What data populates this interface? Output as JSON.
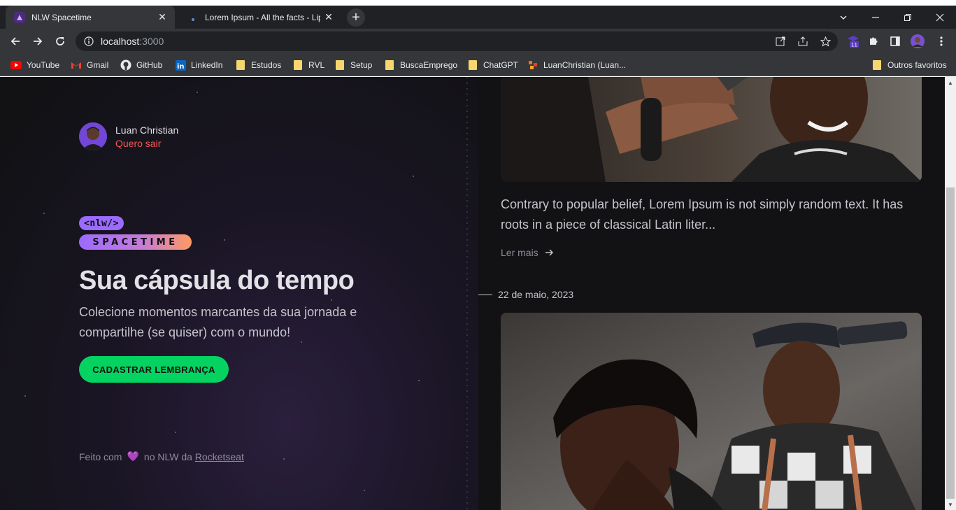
{
  "browser": {
    "tabs": [
      {
        "title": "NLW Spacetime",
        "active": true
      },
      {
        "title": "Lorem Ipsum - All the facts - Lipsum",
        "active": false
      }
    ],
    "close_glyph": "✕",
    "new_tab_glyph": "+",
    "window_controls": {
      "minimize": "—",
      "maximize": "❐",
      "close": "✕",
      "tabsearch": "⌄"
    },
    "url_host": "localhost",
    "url_port": ":3000",
    "extension_badge": "11",
    "bookmarks": [
      {
        "label": "YouTube",
        "icon": "youtube-icon"
      },
      {
        "label": "Gmail",
        "icon": "gmail-icon"
      },
      {
        "label": "GitHub",
        "icon": "github-icon"
      },
      {
        "label": "LinkedIn",
        "icon": "linkedin-icon"
      },
      {
        "label": "Estudos",
        "icon": "folder-icon"
      },
      {
        "label": "RVL",
        "icon": "folder-icon"
      },
      {
        "label": "Setup",
        "icon": "folder-icon"
      },
      {
        "label": "BuscaEmprego",
        "icon": "folder-icon"
      },
      {
        "label": "ChatGPT",
        "icon": "folder-icon"
      },
      {
        "label": "LuanChristian (Luan...",
        "icon": "gitlab-icon"
      }
    ],
    "other_bookmarks": "Outros favoritos"
  },
  "profile": {
    "name": "Luan Christian",
    "logout": "Quero sair"
  },
  "logo": {
    "top": "<nlw/>",
    "bottom": "SPACETIME"
  },
  "hero": {
    "title": "Sua cápsula do tempo",
    "subtitle": "Colecione momentos marcantes da sua jornada e compartilhe (se quiser) com o mundo!",
    "cta": "CADASTRAR LEMBRANÇA"
  },
  "footer": {
    "prefix": "Feito com",
    "middle": "no NLW da",
    "link": "Rocketseat"
  },
  "memories": [
    {
      "excerpt": "Contrary to popular belief, Lorem Ipsum is not simply random text. It has roots in a piece of classical Latin liter...",
      "read_more": "Ler mais"
    },
    {
      "date": "22 de maio, 2023"
    }
  ],
  "colors": {
    "accent_green": "#04d361",
    "logout_red": "#f15a5a",
    "purple": "#8257e5"
  }
}
